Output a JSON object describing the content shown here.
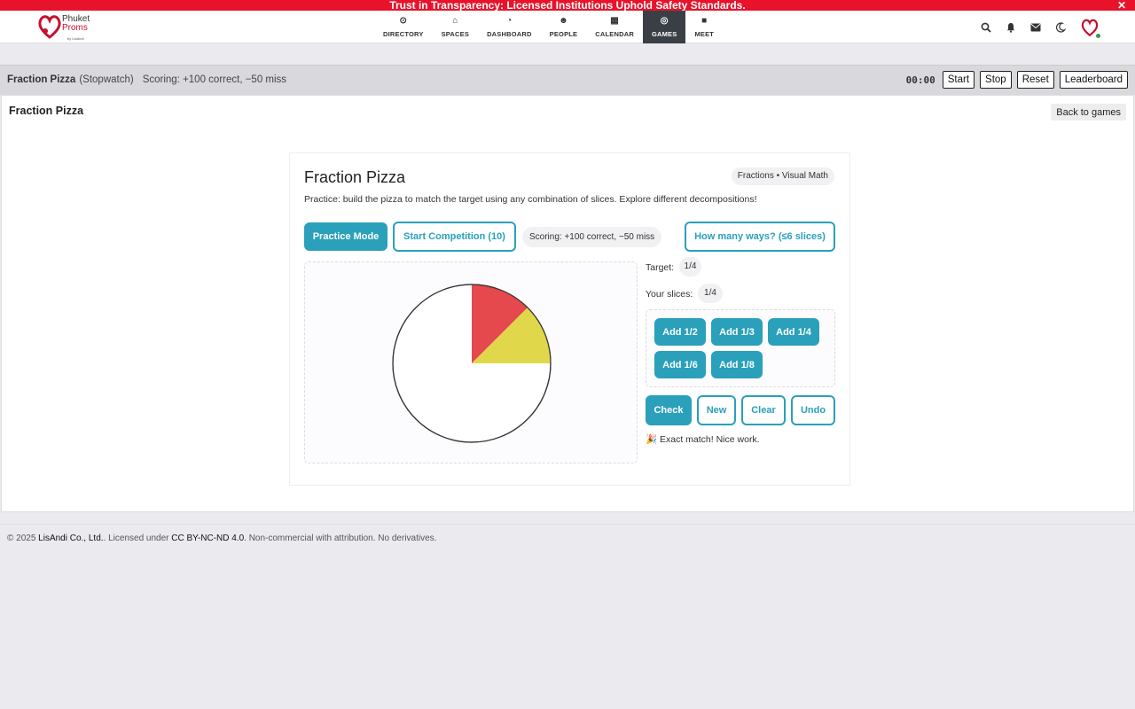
{
  "banner": {
    "text": "Trust in Transparency: Licensed Institutions Uphold Safety Standards.",
    "close": "✕"
  },
  "logo": {
    "line1": "Phuket",
    "line2": "Proms",
    "by": "by LisAndi"
  },
  "nav": [
    {
      "label": "DIRECTORY",
      "icon": "⊙"
    },
    {
      "label": "SPACES",
      "icon": "⌂"
    },
    {
      "label": "DASHBOARD",
      "icon": "◔"
    },
    {
      "label": "PEOPLE",
      "icon": "☻"
    },
    {
      "label": "CALENDAR",
      "icon": "▦"
    },
    {
      "label": "GAMES",
      "icon": "◎"
    },
    {
      "label": "MEET",
      "icon": "■"
    }
  ],
  "gamebar": {
    "title": "Fraction Pizza",
    "mode": "(Stopwatch)",
    "scoring": "Scoring: +100 correct, −50 miss",
    "timer": "00:00",
    "start": "Start",
    "stop": "Stop",
    "reset": "Reset",
    "leaderboard": "Leaderboard"
  },
  "card": {
    "title": "Fraction Pizza",
    "back": "Back to games"
  },
  "panel": {
    "title": "Fraction Pizza",
    "tag": "Fractions • Visual Math",
    "description": "Practice: build the pizza to match the target using any combination of slices. Explore different decompositions!",
    "practice_mode": "Practice Mode",
    "start_competition": "Start Competition (10)",
    "scoring": "Scoring: +100 correct, −50 miss",
    "how_many_ways": "How many ways? (≤6 slices)",
    "target_label": "Target:",
    "target_value": "1/4",
    "slices_label": "Your slices:",
    "slices_value": "1/4",
    "add_buttons": [
      "Add 1/2",
      "Add 1/3",
      "Add 1/4",
      "Add 1/6",
      "Add 1/8"
    ],
    "check": "Check",
    "new": "New",
    "clear": "Clear",
    "undo": "Undo",
    "feedback": "🎉 Exact match! Nice work."
  },
  "pizza": {
    "slices": [
      {
        "fraction": 0.125,
        "color": "#e5484d"
      },
      {
        "fraction": 0.125,
        "color": "#e0d84a"
      }
    ]
  },
  "footer": {
    "copy": "© 2025 ",
    "company": "LisAndi Co., Ltd.",
    "licensed": ". Licensed under ",
    "license": "CC BY-NC-ND 4.0",
    "rest": ". Non-commercial with attribution. No derivatives."
  },
  "colors": {
    "accent": "#2aa0ba",
    "banner": "#e8122a"
  }
}
